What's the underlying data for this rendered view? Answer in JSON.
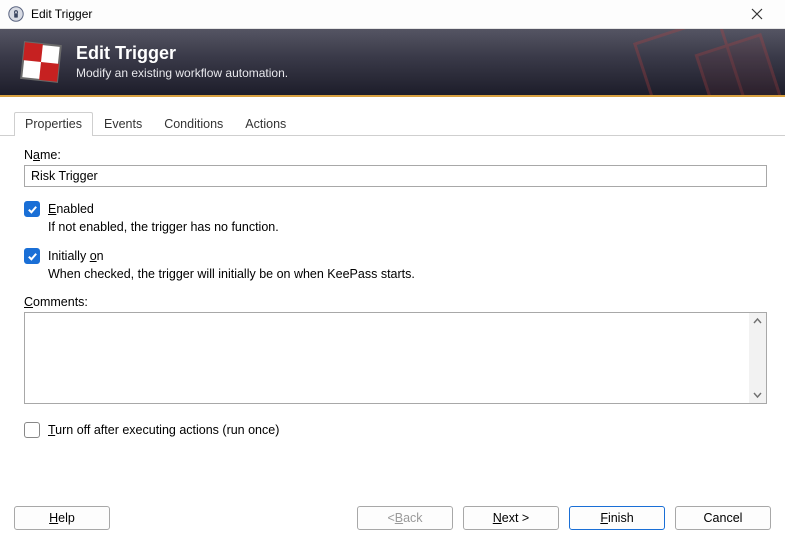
{
  "window": {
    "title": "Edit Trigger"
  },
  "header": {
    "title": "Edit Trigger",
    "subtitle": "Modify an existing workflow automation."
  },
  "tabs": [
    {
      "label": "Properties",
      "active": true
    },
    {
      "label": "Events",
      "active": false
    },
    {
      "label": "Conditions",
      "active": false
    },
    {
      "label": "Actions",
      "active": false
    }
  ],
  "properties": {
    "name_label_pre": "N",
    "name_label_u": "a",
    "name_label_post": "me:",
    "name_value": "Risk Trigger",
    "enabled_u": "E",
    "enabled_post": "nabled",
    "enabled_checked": true,
    "enabled_help": "If not enabled, the trigger has no function.",
    "initially_pre": "Initially ",
    "initially_u": "o",
    "initially_post": "n",
    "initially_checked": true,
    "initially_help": "When checked, the trigger will initially be on when KeePass starts.",
    "comments_u": "C",
    "comments_post": "omments:",
    "comments_value": "",
    "runonce_u": "T",
    "runonce_post": "urn off after executing actions (run once)",
    "runonce_checked": false
  },
  "buttons": {
    "help_u": "H",
    "help_post": "elp",
    "back_pre": "< ",
    "back_u": "B",
    "back_post": "ack",
    "next_u": "N",
    "next_post": "ext >",
    "finish_u": "F",
    "finish_post": "inish",
    "cancel": "Cancel"
  }
}
